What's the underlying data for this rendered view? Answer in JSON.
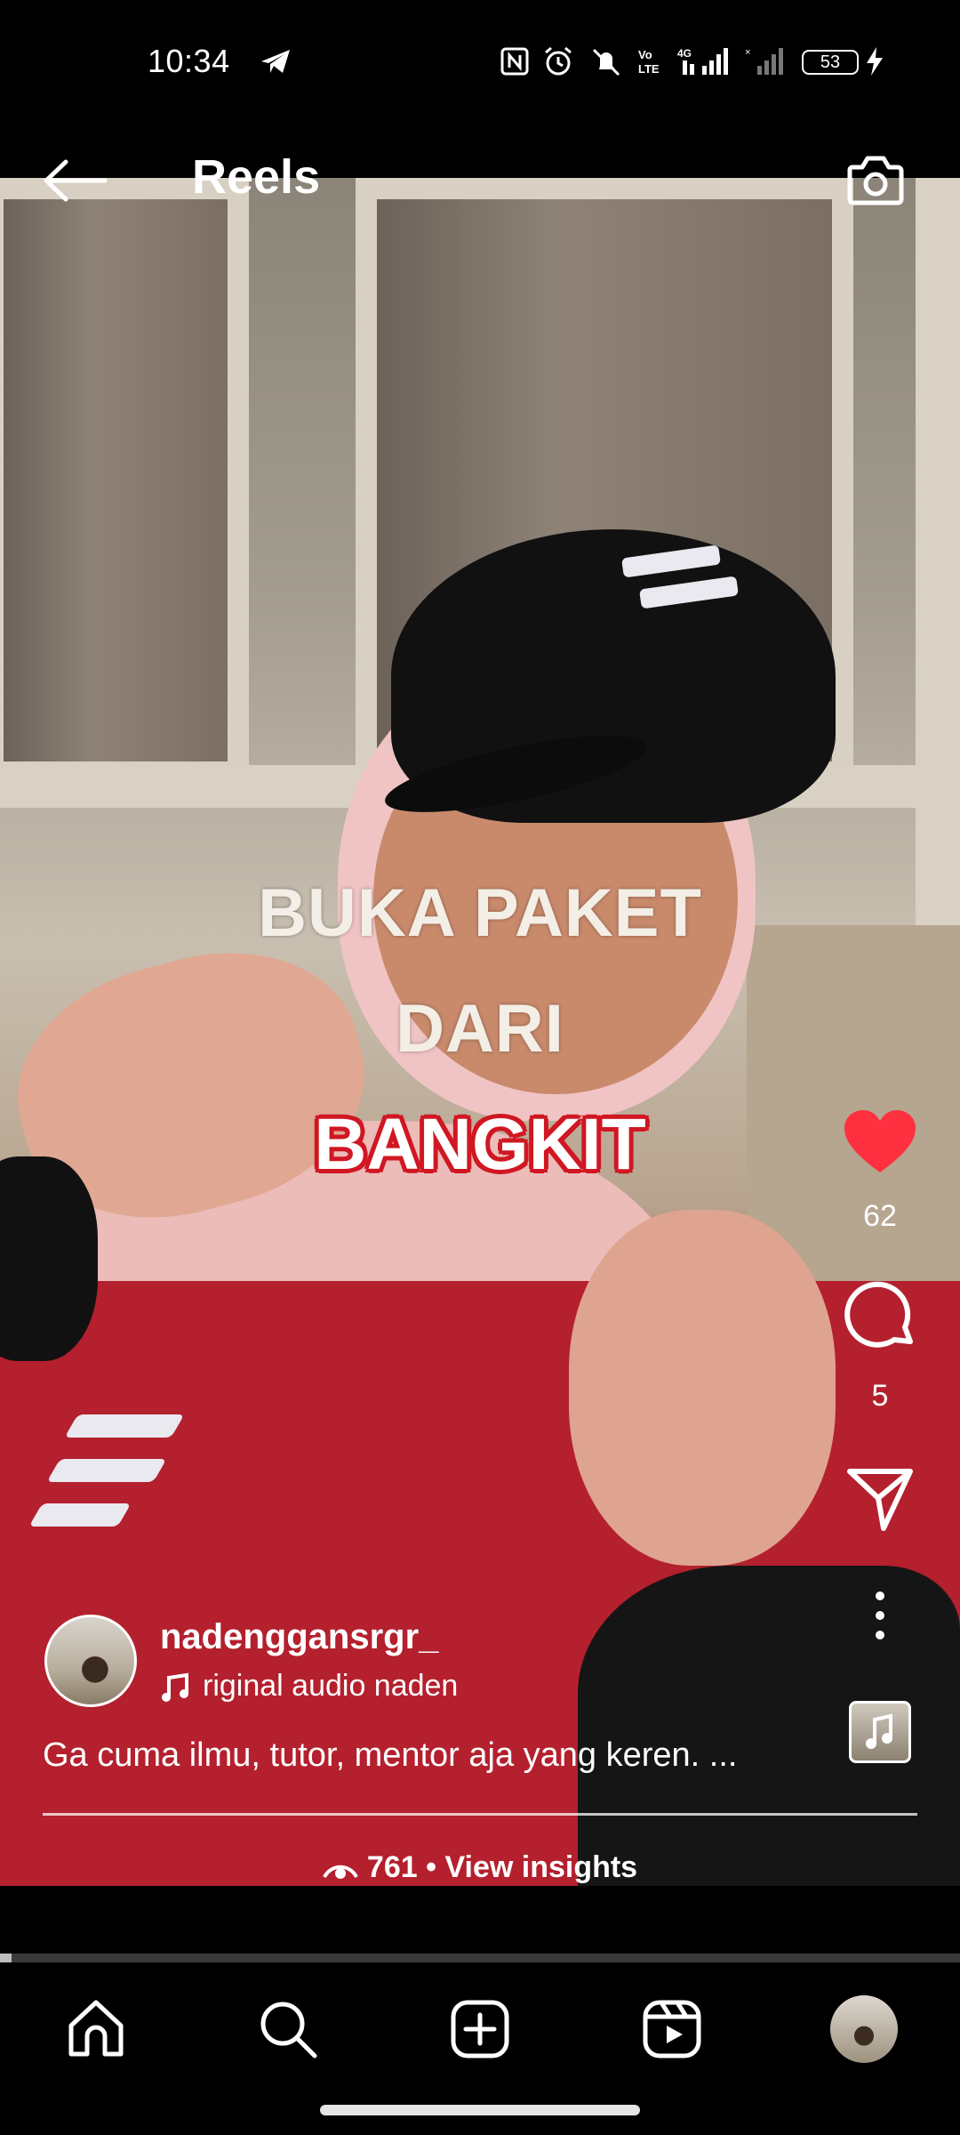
{
  "status_bar": {
    "time": "10:34",
    "network": "4G",
    "battery": "53"
  },
  "header": {
    "title": "Reels"
  },
  "video_overlay": {
    "line1": "BUKA PAKET",
    "line2": "DARI",
    "line3": "BANGKIT"
  },
  "actions": {
    "likes": "62",
    "comments": "5"
  },
  "post": {
    "username": "nadenggansrgr_",
    "audio": "riginal audio    naden",
    "caption": "Ga cuma ilmu, tutor, mentor aja yang keren. ...",
    "views": "761",
    "insights_label": "• View insights"
  },
  "progress": {
    "played_fraction": 0.012
  },
  "icons": {
    "back": "back-arrow-icon",
    "camera": "camera-icon",
    "like": "heart-icon",
    "comment": "comment-icon",
    "share": "send-icon",
    "more": "more-vertical-icon",
    "home": "home-icon",
    "search": "search-icon",
    "create": "plus-square-icon",
    "reels": "reels-icon",
    "profile": "profile-avatar"
  },
  "colors": {
    "like_red": "#ff3040",
    "bangkit_red": "#d01722",
    "background": "#000000"
  }
}
